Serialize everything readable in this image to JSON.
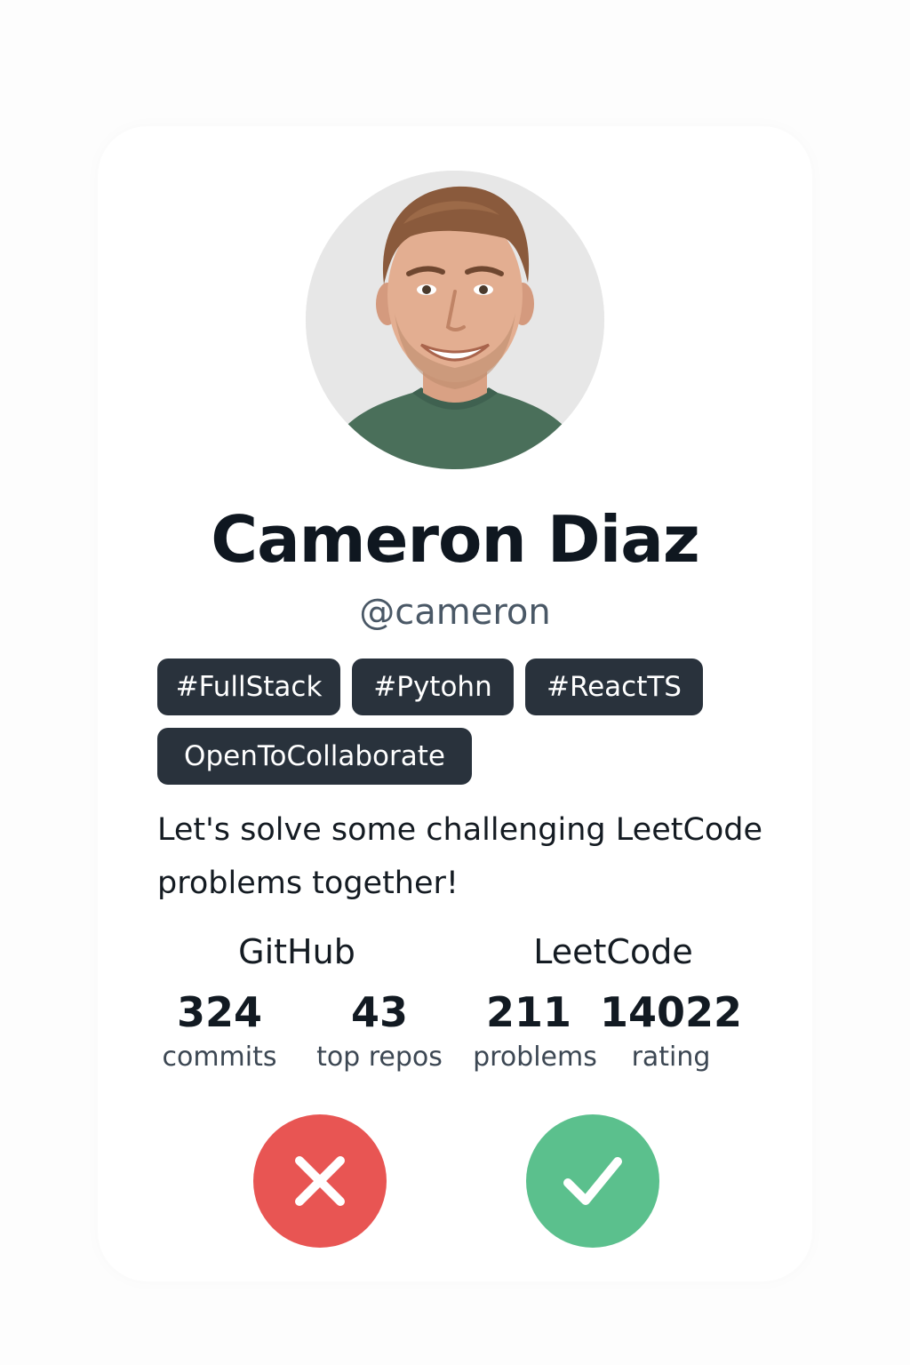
{
  "profile": {
    "name": "Cameron Diaz",
    "handle": "@cameron",
    "bio": "Let's solve some challenging LeetCode problems together!",
    "tags": [
      "#FullStack",
      "#Pytohn",
      "#ReactTS",
      "OpenToCollaborate"
    ]
  },
  "stats": {
    "github": {
      "title": "GitHub",
      "commits": {
        "value": "324",
        "label": "commits"
      },
      "repos": {
        "value": "43",
        "label": "top repos"
      }
    },
    "leetcode": {
      "title": "LeetCode",
      "problems": {
        "value": "211",
        "label": "problems"
      },
      "rating": {
        "value": "14022",
        "label": "rating"
      }
    }
  },
  "actions": {
    "reject_icon": "close-icon",
    "accept_icon": "check-icon",
    "reject_color": "#e85553",
    "accept_color": "#5bc08d"
  },
  "colors": {
    "tag_background": "#29323c",
    "handle_text": "#4a5866"
  }
}
